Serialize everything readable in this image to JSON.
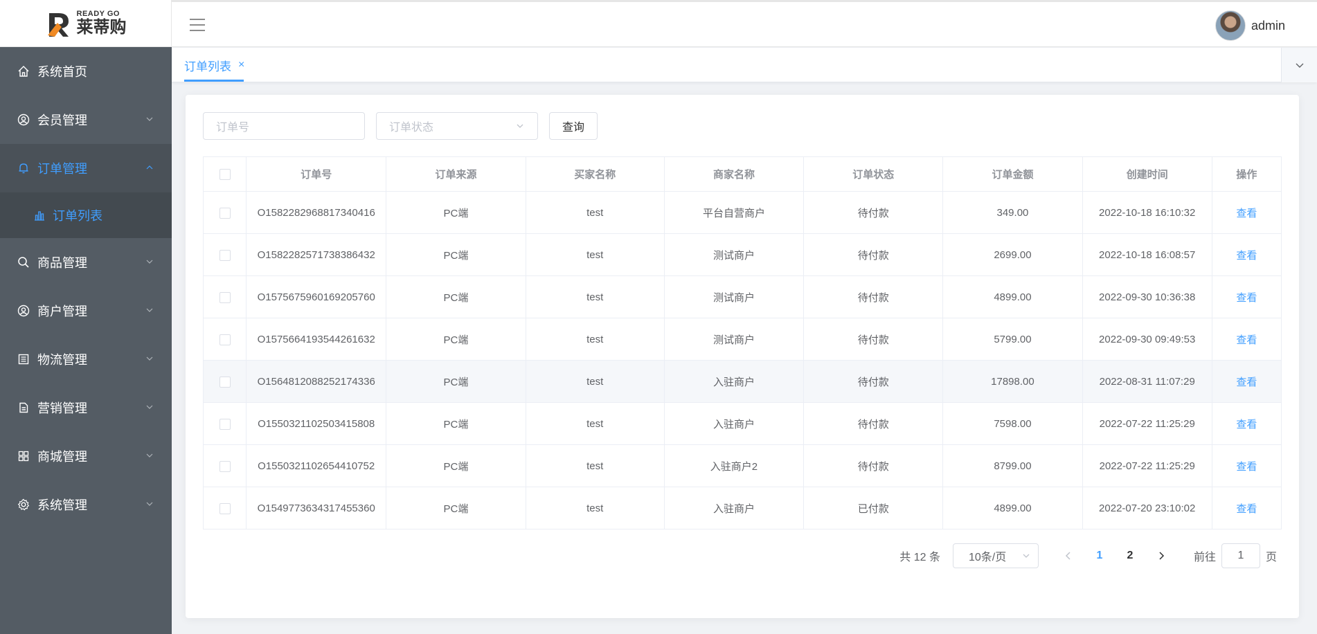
{
  "logo": {
    "en": "READY GO",
    "cn": "莱蒂购"
  },
  "menu": {
    "items": [
      {
        "label": "系统首页",
        "icon": "home-icon"
      },
      {
        "label": "会员管理",
        "icon": "user-circle-icon"
      },
      {
        "label": "订单管理",
        "icon": "bell-icon"
      },
      {
        "label": "商品管理",
        "icon": "search-icon"
      },
      {
        "label": "商户管理",
        "icon": "user-circle-icon"
      },
      {
        "label": "物流管理",
        "icon": "document-list-icon"
      },
      {
        "label": "营销管理",
        "icon": "document-icon"
      },
      {
        "label": "商城管理",
        "icon": "grid-icon"
      },
      {
        "label": "系统管理",
        "icon": "gear-icon"
      }
    ],
    "sub_item": {
      "label": "订单列表",
      "icon": "bar-chart-icon"
    }
  },
  "header": {
    "username": "admin"
  },
  "tabs": {
    "active_label": "订单列表",
    "close_glyph": "×"
  },
  "filters": {
    "order_no_placeholder": "订单号",
    "status_placeholder": "订单状态",
    "query_label": "查询"
  },
  "table": {
    "columns": [
      "订单号",
      "订单来源",
      "买家名称",
      "商家名称",
      "订单状态",
      "订单金额",
      "创建时间",
      "操作"
    ],
    "rows": [
      {
        "order_no": "O1582282968817340416",
        "source": "PC端",
        "buyer": "test",
        "merchant": "平台自营商户",
        "status": "待付款",
        "amount": "349.00",
        "created": "2022-10-18 16:10:32",
        "action": "查看"
      },
      {
        "order_no": "O1582282571738386432",
        "source": "PC端",
        "buyer": "test",
        "merchant": "测试商户",
        "status": "待付款",
        "amount": "2699.00",
        "created": "2022-10-18 16:08:57",
        "action": "查看"
      },
      {
        "order_no": "O1575675960169205760",
        "source": "PC端",
        "buyer": "test",
        "merchant": "测试商户",
        "status": "待付款",
        "amount": "4899.00",
        "created": "2022-09-30 10:36:38",
        "action": "查看"
      },
      {
        "order_no": "O1575664193544261632",
        "source": "PC端",
        "buyer": "test",
        "merchant": "测试商户",
        "status": "待付款",
        "amount": "5799.00",
        "created": "2022-09-30 09:49:53",
        "action": "查看"
      },
      {
        "order_no": "O1564812088252174336",
        "source": "PC端",
        "buyer": "test",
        "merchant": "入驻商户",
        "status": "待付款",
        "amount": "17898.00",
        "created": "2022-08-31 11:07:29",
        "action": "查看"
      },
      {
        "order_no": "O1550321102503415808",
        "source": "PC端",
        "buyer": "test",
        "merchant": "入驻商户",
        "status": "待付款",
        "amount": "7598.00",
        "created": "2022-07-22 11:25:29",
        "action": "查看"
      },
      {
        "order_no": "O1550321102654410752",
        "source": "PC端",
        "buyer": "test",
        "merchant": "入驻商户2",
        "status": "待付款",
        "amount": "8799.00",
        "created": "2022-07-22 11:25:29",
        "action": "查看"
      },
      {
        "order_no": "O1549773634317455360",
        "source": "PC端",
        "buyer": "test",
        "merchant": "入驻商户",
        "status": "已付款",
        "amount": "4899.00",
        "created": "2022-07-20 23:10:02",
        "action": "查看"
      }
    ]
  },
  "pagination": {
    "total_text": "共 12 条",
    "page_size": "10条/页",
    "pages": [
      "1",
      "2"
    ],
    "current_page": "1",
    "goto_prefix": "前往",
    "goto_value": "1",
    "goto_suffix": "页"
  },
  "colors": {
    "accent": "#409eff",
    "sidebar_bg": "#545c64"
  }
}
